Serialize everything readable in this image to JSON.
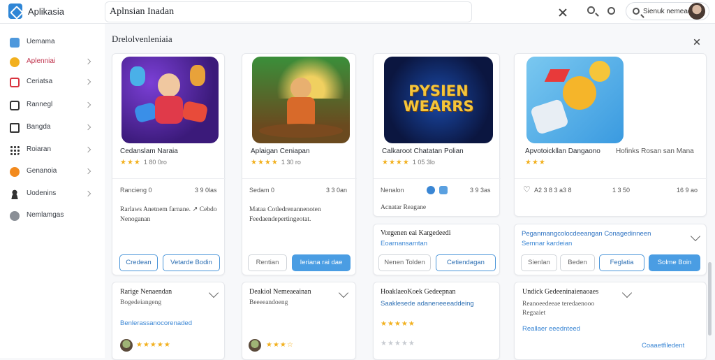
{
  "app": {
    "title": "Aplikasia",
    "search_value": "Aplnsian Inadan"
  },
  "topbar": {
    "user_search_label": "Sienuk nemeadah"
  },
  "sidebar": {
    "items": [
      {
        "label": "Uemama",
        "icon": "home-icon",
        "color": "#2f86d6"
      },
      {
        "label": "Aplenniai",
        "icon": "alert-icon",
        "color": "#f2b01e"
      },
      {
        "label": "Ceriatsa",
        "icon": "gallery-icon",
        "color": "#d9333f"
      },
      {
        "label": "Rannegl",
        "icon": "book-icon",
        "color": "#333333"
      },
      {
        "label": "Bangda",
        "icon": "document-icon",
        "color": "#333333"
      },
      {
        "label": "Roiaran",
        "icon": "grid-icon",
        "color": "#333333"
      },
      {
        "label": "Genanoia",
        "icon": "star-badge-icon",
        "color": "#f28a1e"
      },
      {
        "label": "Uodenins",
        "icon": "user-icon",
        "color": "#333333"
      },
      {
        "label": "Nemlamgas",
        "icon": "globe-icon",
        "color": "#777777"
      }
    ]
  },
  "main": {
    "title": "Drelolvenleniaia"
  },
  "games": [
    {
      "name": "Cedanslam Naraia",
      "stars": "★★★",
      "count": "1 80 0ro",
      "meta_left": "Rancieng 0",
      "meta_right": "3 9 0las",
      "desc": "Rarlaws Anetnem farnane. ↗  Cebdo Nenoganan",
      "btn1": "Credean",
      "btn2": "Vetarde Bodin"
    },
    {
      "name": "Aplaigan Ceniapan",
      "stars": "★★★★",
      "count": "1 30 ro",
      "meta_left": "Sedam 0",
      "meta_right": "3 3 0an",
      "desc": "Mataa Cotledrenannenoten Feedaendepertingeotat.",
      "btn1": "Rentian",
      "btn2": "Ieriana rai dae"
    },
    {
      "name": "Calkaroot Chatatan Polian",
      "stars": "★★★★",
      "count": "1 05 3lo",
      "meta_left": "Nenalon",
      "meta_right": "3 9 3as",
      "desc": "Acnatar Reagane",
      "banner": "PYSIEN WEARRS",
      "btn1": "Nenen Tolden",
      "btn2": "Cetiendagan"
    },
    {
      "name": "Apvotoickllan Dangaono",
      "extra": "Hofinks Rosan san Mana",
      "stars": "★★★",
      "count": "",
      "meta_left": "A2 3 8 3 a3 8",
      "meta_mid": "1 3 50",
      "meta_right": "16 9 ao",
      "btn1": "Sienlan",
      "btn2": "Beden",
      "btn3": "Feglatia",
      "btn4": "Solme Boin"
    }
  ],
  "mid_row": [
    {
      "title": "Vorgenen eai Kargedeedi",
      "link": "Eoarnansamtan"
    },
    {
      "title": "Peganmangcolocdeeangan Conagedinneen",
      "link": "Semnar kardeian"
    }
  ],
  "bottom_row": [
    {
      "title": "Rarige Nenaendan",
      "sub": "Bogedeiangeng",
      "link": "Benlerassanocorenaded",
      "rating": "★★★★★"
    },
    {
      "title": "Deakiol Nemeaeainan",
      "sub": "Beeeeandoeng",
      "rating": "★★★☆"
    },
    {
      "title": "HoaklaeoKoek Gedeepnan",
      "link": "Saaklesede adaneneeeaddeing",
      "rating": "★★★★★"
    },
    {
      "title": "Undick Gedeeninaienaoaes",
      "sub": "Reanoeedeeae teredaenooo",
      "sub2": "Regaaiet",
      "link": "Reallaer eeednteed",
      "action": "Coaaetfiledent"
    }
  ]
}
